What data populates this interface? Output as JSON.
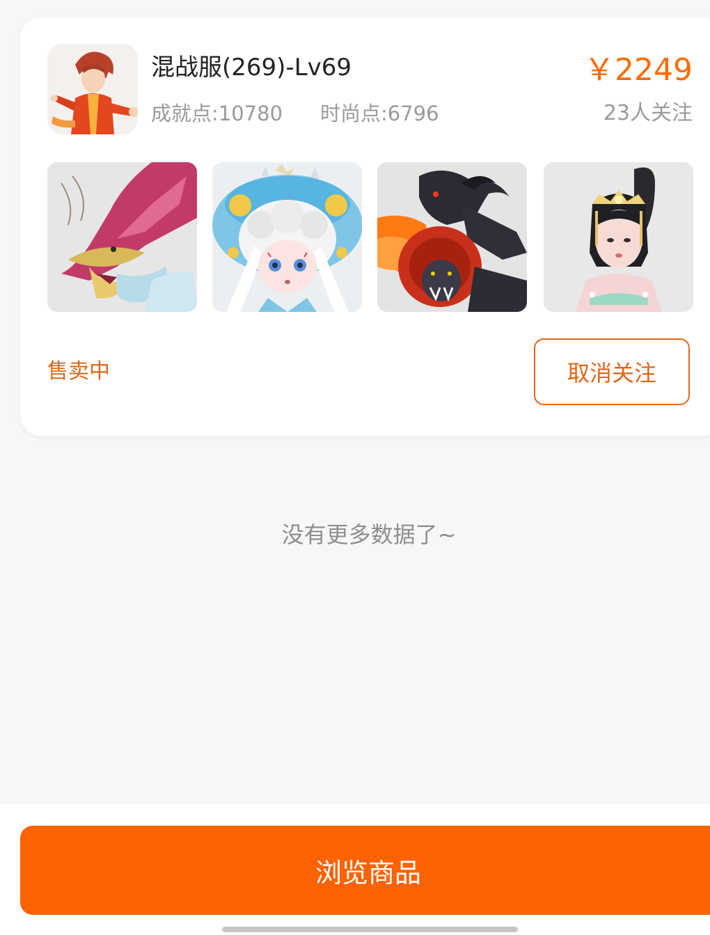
{
  "account": {
    "title": "混战服(269)-Lv69",
    "achievement": "成就点:10780",
    "fashion": "时尚点:6796",
    "price": "￥2249",
    "followers": "23人关注",
    "status": "售卖中",
    "unfollow_label": "取消关注"
  },
  "thumbnails": [
    {
      "icon": "dragon-icon"
    },
    {
      "icon": "cloud-girl-icon"
    },
    {
      "icon": "black-ram-beast-icon"
    },
    {
      "icon": "dancer-girl-icon"
    }
  ],
  "empty_hint": "没有更多数据了~",
  "browse_label": "浏览商品",
  "colors": {
    "accent": "#ff6200",
    "status": "#e0661a",
    "muted": "#9a9a9a",
    "background": "#f7f7f7"
  }
}
